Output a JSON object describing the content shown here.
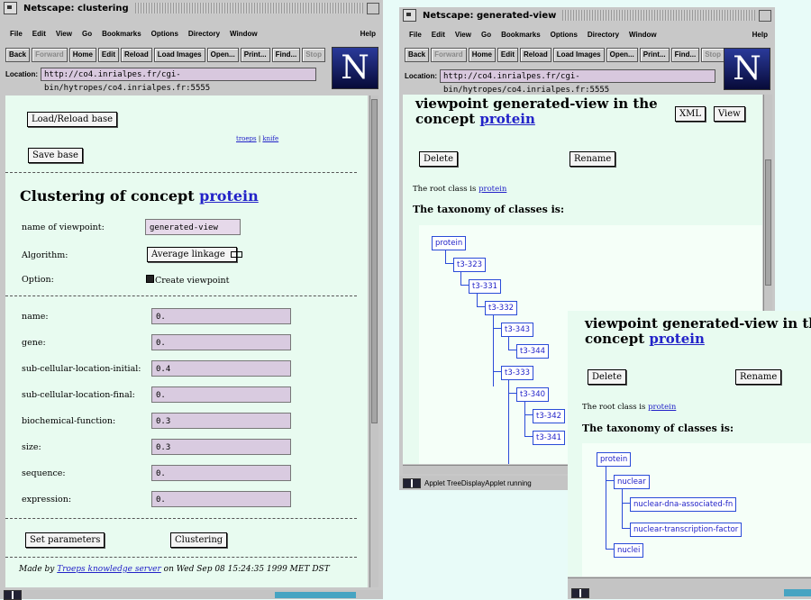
{
  "left_window": {
    "title": "Netscape: clustering",
    "menu": [
      "File",
      "Edit",
      "View",
      "Go",
      "Bookmarks",
      "Options",
      "Directory",
      "Window"
    ],
    "help": "Help",
    "toolbar": [
      "Back",
      "Forward",
      "Home",
      "Edit",
      "Reload",
      "Load Images",
      "Open...",
      "Print...",
      "Find...",
      "Stop"
    ],
    "location_label": "Location:",
    "location_url": "http://co4.inrialpes.fr/cgi-bin/hytropes/co4.inrialpes.fr:5555",
    "load_button": "Load/Reload base",
    "save_button": "Save base",
    "link_troeps": "troeps",
    "link_sep": "|",
    "link_knife": "knife",
    "heading_prefix": "Clustering of concept",
    "heading_concept": "protein",
    "viewpoint_label": "name of viewpoint:",
    "viewpoint_value": "generated-view",
    "algorithm_label": "Algorithm:",
    "algorithm_value": "Average linkage",
    "option_label": "Option:",
    "option_value": "Create viewpoint",
    "params": [
      {
        "label": "name:",
        "value": "0."
      },
      {
        "label": "gene:",
        "value": "0."
      },
      {
        "label": "sub-cellular-location-initial:",
        "value": "0.4"
      },
      {
        "label": "sub-cellular-location-final:",
        "value": "0."
      },
      {
        "label": "biochemical-function:",
        "value": "0.3"
      },
      {
        "label": "size:",
        "value": "0.3"
      },
      {
        "label": "sequence:",
        "value": "0."
      },
      {
        "label": "expression:",
        "value": "0."
      }
    ],
    "set_params_button": "Set parameters",
    "clustering_button": "Clustering",
    "footer_prefix": "Made by",
    "footer_link": "Troeps knowledge server",
    "footer_suffix": "on Wed Sep 08 15:24:35 1999 MET DST"
  },
  "right_window": {
    "title": "Netscape: generated-view",
    "menu": [
      "File",
      "Edit",
      "View",
      "Go",
      "Bookmarks",
      "Options",
      "Directory",
      "Window"
    ],
    "help": "Help",
    "toolbar": [
      "Back",
      "Forward",
      "Home",
      "Edit",
      "Reload",
      "Load Images",
      "Open...",
      "Print...",
      "Find...",
      "Stop"
    ],
    "location_label": "Location:",
    "location_url": "http://co4.inrialpes.fr/cgi-bin/hytropes/co4.inrialpes.fr:5555",
    "heading_line1": "viewpoint generated-view in the",
    "heading_line2_prefix": "concept",
    "heading_concept": "protein",
    "xml_button": "XML",
    "view_button": "View",
    "delete_button": "Delete",
    "rename_button": "Rename",
    "root_prefix": "The root class is",
    "root_link": "protein",
    "taxonomy_heading": "The taxonomy of classes is:",
    "tree_nodes": [
      "protein",
      "t3-323",
      "t3-331",
      "t3-332",
      "t3-343",
      "t3-344",
      "t3-333",
      "t3-340",
      "t3-342",
      "t3-341"
    ],
    "status_text": "Applet TreeDisplayApplet running"
  },
  "front_panel": {
    "heading_line1": "viewpoint generated-view in the",
    "heading_line2_prefix": "concept",
    "heading_concept": "protein",
    "delete_button": "Delete",
    "rename_button": "Rename",
    "root_prefix": "The root class is",
    "root_link": "protein",
    "taxonomy_heading": "The taxonomy of classes is:",
    "tree_nodes": [
      "protein",
      "nuclear",
      "nuclear-dna-associated-fn",
      "nuclear-transcription-factor",
      "nuclei"
    ]
  }
}
